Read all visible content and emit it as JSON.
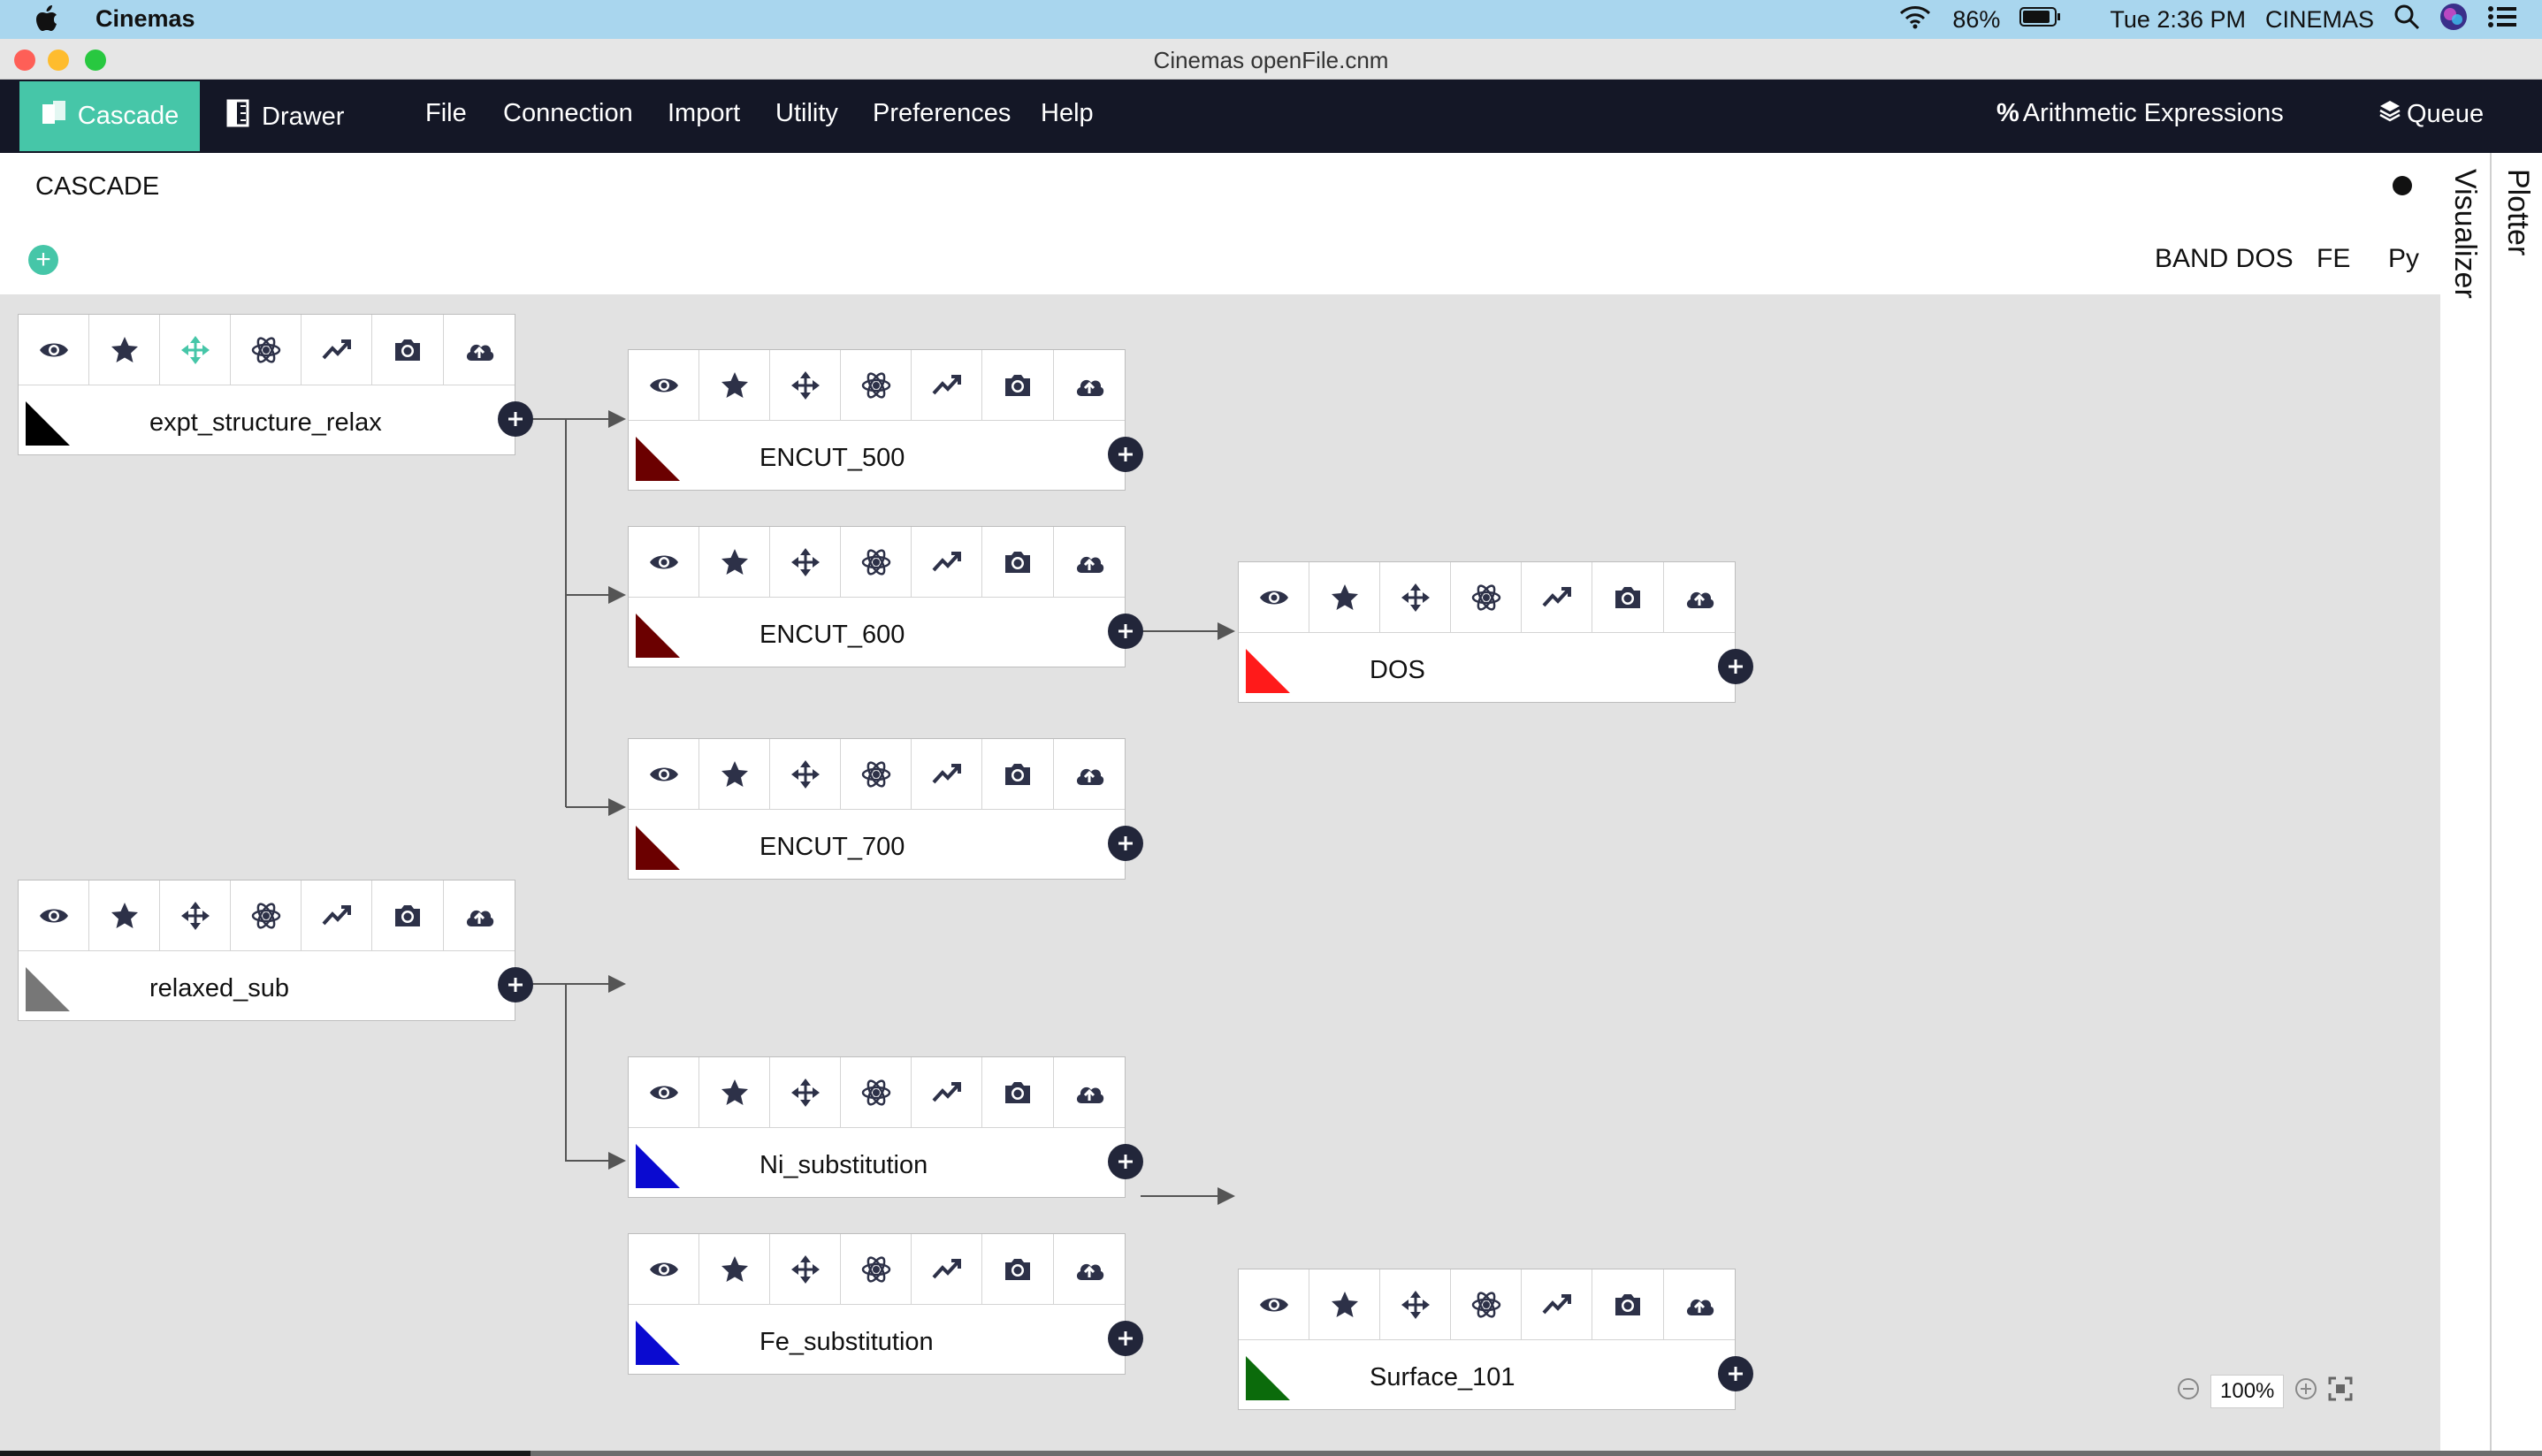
{
  "menubar": {
    "app_name": "Cinemas",
    "battery": "86%",
    "clock": "Tue 2:36 PM",
    "right_label": "CINEMAS"
  },
  "window": {
    "title": "Cinemas openFile.cnm"
  },
  "nav": {
    "cascade": "Cascade",
    "drawer": "Drawer",
    "file": "File",
    "connection": "Connection",
    "import": "Import",
    "utility": "Utility",
    "preferences": "Preferences",
    "help": "Help",
    "arith": "Arithmetic Expressions",
    "queue": "Queue"
  },
  "header": {
    "title": "CASCADE",
    "tabs": [
      "BAND DOS",
      "FE",
      "Py"
    ]
  },
  "side_tabs": [
    "Visualizer",
    "Plotter"
  ],
  "toolbar_icons": [
    "eye-icon",
    "star-icon",
    "move-icon",
    "atom-icon",
    "trend-icon",
    "camera-icon",
    "cloud-upload-icon"
  ],
  "nodes": [
    {
      "name": "expt_structure_relax",
      "color": "#000000"
    },
    {
      "name": "ENCUT_500",
      "color": "#6b0000"
    },
    {
      "name": "ENCUT_600",
      "color": "#6b0000"
    },
    {
      "name": "ENCUT_700",
      "color": "#6b0000"
    },
    {
      "name": "DOS",
      "color": "#ff1a1a"
    },
    {
      "name": "relaxed_sub",
      "color": "#777777"
    },
    {
      "name": "Ni_substitution",
      "color": "#0a0ad0"
    },
    {
      "name": "Fe_substitution",
      "color": "#0a0ad0"
    },
    {
      "name": "Surface_101",
      "color": "#0b6b0b"
    }
  ],
  "zoom": {
    "level": "100%"
  },
  "colors": {
    "accent": "#46c6a8",
    "nav_bg": "#141726",
    "canvas_bg": "#e2e2e2"
  }
}
